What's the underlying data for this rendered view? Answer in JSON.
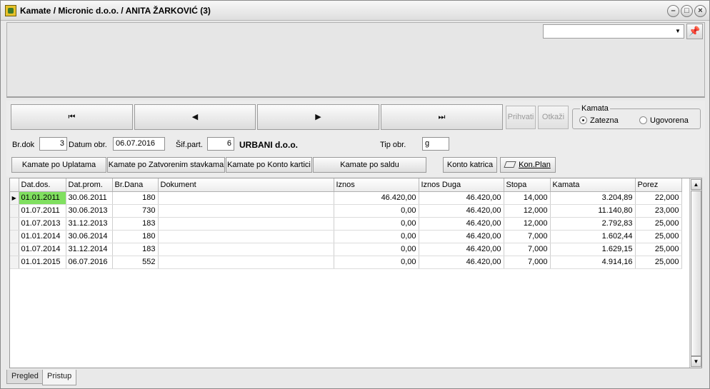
{
  "window": {
    "title": "Kamate / Micronic d.o.o. / ANITA ŽARKOVIĆ (3)"
  },
  "top": {
    "combo_value": ""
  },
  "nav": {
    "first": "⏮",
    "prev": "◀",
    "next": "▶",
    "last": "⏭"
  },
  "actions": {
    "accept": "Prihvati",
    "cancel": "Otkaži"
  },
  "kamata": {
    "label": "Kamata",
    "options": [
      "Zatezna",
      "Ugovorena"
    ],
    "selected": "Zatezna"
  },
  "form": {
    "br_dok_label": "Br.dok",
    "br_dok": "3",
    "datum_label": "Datum obr.",
    "datum": "06.07.2016",
    "sif_part_label": "Šif.part.",
    "sif_part": "6",
    "partner_name": "URBANI d.o.o.",
    "tip_label": "Tip obr.",
    "tip": "g"
  },
  "buttons": {
    "po_uplatama": "Kamate po Uplatama",
    "po_zatvorenim": "Kamate po Zatvorenim stavkama",
    "po_konto": "Kamate po Konto kartici",
    "po_saldu": "Kamate po saldu",
    "konto_katrica": "Konto katrica",
    "kon_plan": "Kon.Plan"
  },
  "table": {
    "columns": [
      "Dat.dos.",
      "Dat.prom.",
      "Br.Dana",
      "Dokument",
      "Iznos",
      "Iznos Duga",
      "Stopa",
      "Kamata",
      "Porez"
    ],
    "rows": [
      [
        "01.01.2011",
        "30.06.2011",
        "180",
        "",
        "46.420,00",
        "46.420,00",
        "14,000",
        "3.204,89",
        "22,000"
      ],
      [
        "01.07.2011",
        "30.06.2013",
        "730",
        "",
        "0,00",
        "46.420,00",
        "12,000",
        "11.140,80",
        "23,000"
      ],
      [
        "01.07.2013",
        "31.12.2013",
        "183",
        "",
        "0,00",
        "46.420,00",
        "12,000",
        "2.792,83",
        "25,000"
      ],
      [
        "01.01.2014",
        "30.06.2014",
        "180",
        "",
        "0,00",
        "46.420,00",
        "7,000",
        "1.602,44",
        "25,000"
      ],
      [
        "01.07.2014",
        "31.12.2014",
        "183",
        "",
        "0,00",
        "46.420,00",
        "7,000",
        "1.629,15",
        "25,000"
      ],
      [
        "01.01.2015",
        "06.07.2016",
        "552",
        "",
        "0,00",
        "46.420,00",
        "7,000",
        "4.914,16",
        "25,000"
      ]
    ]
  },
  "tabs": [
    {
      "label": "Pregled"
    },
    {
      "label": "Pristup"
    }
  ],
  "colors": {
    "selected_cell": "#80e060"
  }
}
